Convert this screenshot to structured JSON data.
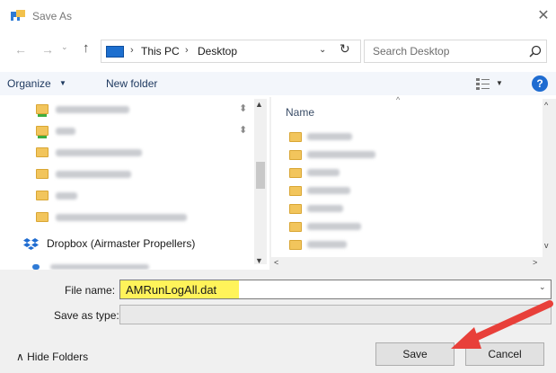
{
  "window": {
    "title": "Save As",
    "close_glyph": "✕"
  },
  "nav": {
    "back_glyph": "←",
    "forward_glyph": "→",
    "recent_glyph": "⌄",
    "up_glyph": "↑",
    "breadcrumb_sep": "›",
    "breadcrumb": [
      "This PC",
      "Desktop"
    ],
    "dropdown_glyph": "⌄",
    "refresh_glyph": "↻",
    "search_placeholder": "Search Desktop"
  },
  "toolbar": {
    "organize_label": "Organize",
    "caret": "▼",
    "new_folder_label": "New folder",
    "help_label": "?"
  },
  "navpane": {
    "items": [
      {
        "label": "PDF Drawings",
        "blurred": true,
        "pinned": true,
        "icon": "green-folder-icon"
      },
      {
        "label": "apl",
        "blurred": true,
        "pinned": true,
        "icon": "green-folder-icon"
      },
      {
        "label": "3.3.1 Owners Manuals",
        "blurred": true,
        "icon": "folder-icon"
      },
      {
        "label": "Blade Assemblies",
        "blurred": true,
        "icon": "folder-icon"
      },
      {
        "label": "rev2",
        "blurred": true,
        "icon": "folder-icon"
      },
      {
        "label": "D-0011 AC200 Diagnostics Tool",
        "blurred": true,
        "icon": "folder-icon"
      }
    ],
    "pin_glyph": "📌",
    "dropbox_label": "Dropbox (Airmaster Propellers)",
    "scroll_up_glyph": "▲",
    "scroll_down_glyph": "▼"
  },
  "filelist": {
    "column_name": "Name",
    "sort_glyph": "^",
    "items": [
      "Converted",
      "Desktop Images",
      "Freccia",
      "Hub Parts",
      "Images",
      "old desktop",
      "Quotes"
    ],
    "scroll_left_glyph": "<",
    "scroll_right_glyph": ">",
    "scroll_up_glyph": "^",
    "scroll_down_glyph": "v"
  },
  "form": {
    "filename_label": "File name:",
    "filename_value": "AMRunLogAll.dat",
    "savetype_label": "Save as type:",
    "dropdown_glyph": "⌄",
    "hide_folders_label": "∧  Hide Folders",
    "save_label": "Save",
    "cancel_label": "Cancel"
  },
  "colors": {
    "highlight": "#fff35a",
    "annotation_arrow": "#e8403a",
    "accent": "#1f6cd1"
  }
}
